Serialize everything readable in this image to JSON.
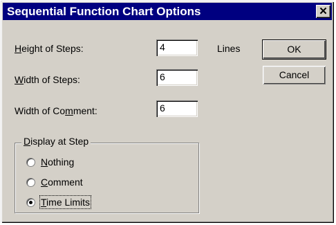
{
  "window": {
    "title": "Sequential Function Chart Options",
    "close_symbol": "✕"
  },
  "fields": {
    "height_of_steps": {
      "label_pre": "",
      "label_ul": "H",
      "label_post": "eight of Steps:",
      "value": "4",
      "unit": "Lines"
    },
    "width_of_steps": {
      "label_pre": "",
      "label_ul": "W",
      "label_post": "idth of Steps:",
      "value": "6"
    },
    "width_of_comment": {
      "label_pre": "Width of Co",
      "label_ul": "m",
      "label_post": "ment:",
      "value": "6"
    }
  },
  "buttons": {
    "ok": "OK",
    "cancel": "Cancel"
  },
  "display_group": {
    "legend_ul": "D",
    "legend_rest": "isplay at Step",
    "options": [
      {
        "ul": "N",
        "rest": "othing",
        "selected": false
      },
      {
        "ul": "C",
        "rest": "omment",
        "selected": false
      },
      {
        "ul": "T",
        "rest": "ime Limits",
        "selected": true
      }
    ]
  }
}
